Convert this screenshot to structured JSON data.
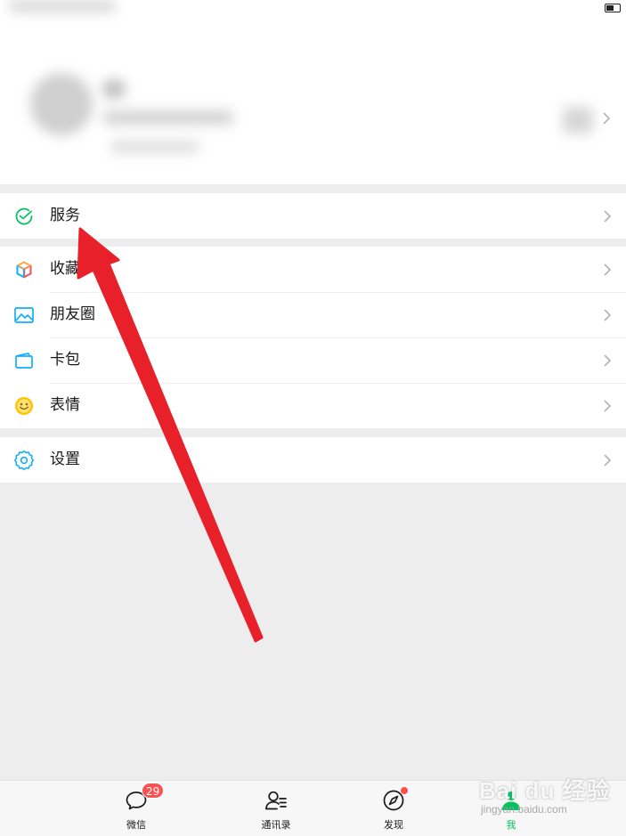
{
  "menu": {
    "services": "服务",
    "favorites": "收藏",
    "moments": "朋友圈",
    "cards": "卡包",
    "stickers": "表情",
    "settings": "设置"
  },
  "tabbar": {
    "chats": "微信",
    "chats_badge": "29",
    "contacts": "通讯录",
    "discover": "发现",
    "me": "我"
  },
  "watermark": {
    "main": "Bai du 经验",
    "sub": "jingyan.baidu.com"
  },
  "colors": {
    "accent_green": "#07c160",
    "badge_red": "#fa5151",
    "annotation_arrow": "#e8202a",
    "background": "#ededed"
  },
  "icons": {
    "services": "services-check-icon",
    "favorites": "favorites-cube-icon",
    "moments": "moments-photo-icon",
    "cards": "card-wallet-icon",
    "stickers": "sticker-smile-icon",
    "settings": "settings-gear-icon"
  }
}
